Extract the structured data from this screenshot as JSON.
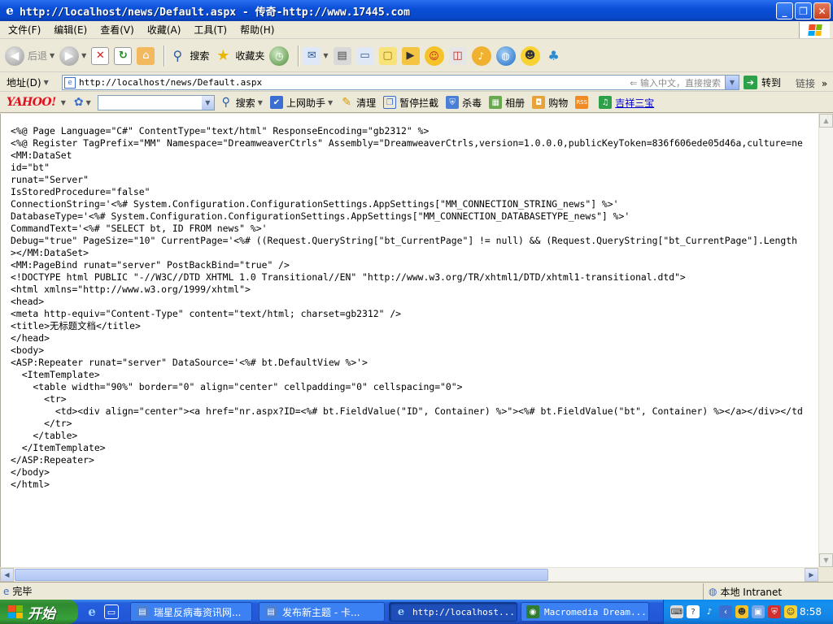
{
  "window": {
    "title": "http://localhost/news/Default.aspx - 传奇-http://www.17445.com"
  },
  "menu": [
    "文件(F)",
    "编辑(E)",
    "查看(V)",
    "收藏(A)",
    "工具(T)",
    "帮助(H)"
  ],
  "toolbar": {
    "back_label": "后退",
    "search_label": "搜索",
    "favorites_label": "收藏夹"
  },
  "address": {
    "label": "地址(D)",
    "url": "http://localhost/news/Default.aspx",
    "hint": "输入中文，直接搜索",
    "go_label": "转到",
    "links_label": "链接"
  },
  "yahoo_bar": {
    "logo": "YAHOO!",
    "search_label": "搜索",
    "assistant_label": "上网助手",
    "clean_label": "清理",
    "popup_label": "暂停拦截",
    "antivirus_label": "杀毒",
    "album_label": "相册",
    "shopping_label": "购物",
    "link_label": "吉祥三宝"
  },
  "page_source": [
    "<%@ Page Language=\"C#\" ContentType=\"text/html\" ResponseEncoding=\"gb2312\" %>",
    "<%@ Register TagPrefix=\"MM\" Namespace=\"DreamweaverCtrls\" Assembly=\"DreamweaverCtrls,version=1.0.0.0,publicKeyToken=836f606ede05d46a,culture=ne",
    "<MM:DataSet",
    "id=\"bt\"",
    "runat=\"Server\"",
    "IsStoredProcedure=\"false\"",
    "ConnectionString='<%# System.Configuration.ConfigurationSettings.AppSettings[\"MM_CONNECTION_STRING_news\"] %>'",
    "DatabaseType='<%# System.Configuration.ConfigurationSettings.AppSettings[\"MM_CONNECTION_DATABASETYPE_news\"] %>'",
    "CommandText='<%# \"SELECT bt, ID FROM news\" %>'",
    "Debug=\"true\" PageSize=\"10\" CurrentPage='<%# ((Request.QueryString[\"bt_CurrentPage\"] != null) && (Request.QueryString[\"bt_CurrentPage\"].Length",
    "></MM:DataSet>",
    "<MM:PageBind runat=\"server\" PostBackBind=\"true\" />",
    "<!DOCTYPE html PUBLIC \"-//W3C//DTD XHTML 1.0 Transitional//EN\" \"http://www.w3.org/TR/xhtml1/DTD/xhtml1-transitional.dtd\">",
    "<html xmlns=\"http://www.w3.org/1999/xhtml\">",
    "<head>",
    "<meta http-equiv=\"Content-Type\" content=\"text/html; charset=gb2312\" />",
    "<title>无标题文档</title>",
    "</head>",
    "<body>",
    "<ASP:Repeater runat=\"server\" DataSource='<%# bt.DefaultView %>'>",
    "  <ItemTemplate>",
    "    <table width=\"90%\" border=\"0\" align=\"center\" cellpadding=\"0\" cellspacing=\"0\">",
    "      <tr>",
    "        <td><div align=\"center\"><a href=\"nr.aspx?ID=<%# bt.FieldValue(\"ID\", Container) %>\"><%# bt.FieldValue(\"bt\", Container) %></a></div></td",
    "      </tr>",
    "    </table>",
    "  </ItemTemplate>",
    "</ASP:Repeater>",
    "</body>",
    "</html>"
  ],
  "status": {
    "text": "完毕",
    "zone": "本地 Intranet"
  },
  "taskbar": {
    "start_label": "开始",
    "tasks": [
      "瑞星反病毒资讯网...",
      "发布新主题 - 卡...",
      "http://localhost...",
      "Macromedia Dream..."
    ],
    "clock": "8:58"
  }
}
